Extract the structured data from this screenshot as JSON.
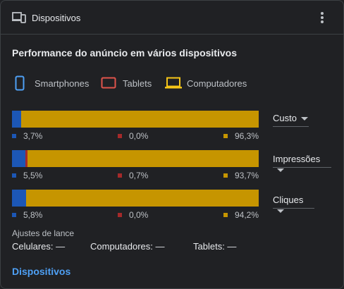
{
  "header": {
    "title": "Dispositivos",
    "icon": "devices-icon",
    "menu_icon": "more-vert-icon"
  },
  "section_title": "Performance do anúncio em vários dispositivos",
  "legend": [
    {
      "label": "Smartphones",
      "icon": "smartphone-icon",
      "color": "#4ea0f5"
    },
    {
      "label": "Tablets",
      "icon": "tablet-icon",
      "color": "#e0544b"
    },
    {
      "label": "Computadores",
      "icon": "laptop-icon",
      "color": "#f5c518"
    }
  ],
  "colors": {
    "smartphones": "#1c57b6",
    "tablets": "#a52a2a",
    "computadores": "#c69500"
  },
  "metrics": [
    {
      "dropdown": "Custo",
      "smartphones": "3,7%",
      "tablets": "0,0%",
      "computadores": "96,3%",
      "fractions": [
        0.037,
        0.0,
        0.963
      ]
    },
    {
      "dropdown": "Impressões",
      "smartphones": "5,5%",
      "tablets": "0,7%",
      "computadores": "93,7%",
      "fractions": [
        0.055,
        0.007,
        0.937
      ]
    },
    {
      "dropdown": "Cliques",
      "smartphones": "5,8%",
      "tablets": "0,0%",
      "computadores": "94,2%",
      "fractions": [
        0.058,
        0.0,
        0.942
      ]
    }
  ],
  "adjustments": {
    "title": "Ajustes de lance",
    "mobile": "Celulares: —",
    "desktop": "Computadores: —",
    "tablet": "Tablets: —"
  },
  "footer_link": "Dispositivos"
}
